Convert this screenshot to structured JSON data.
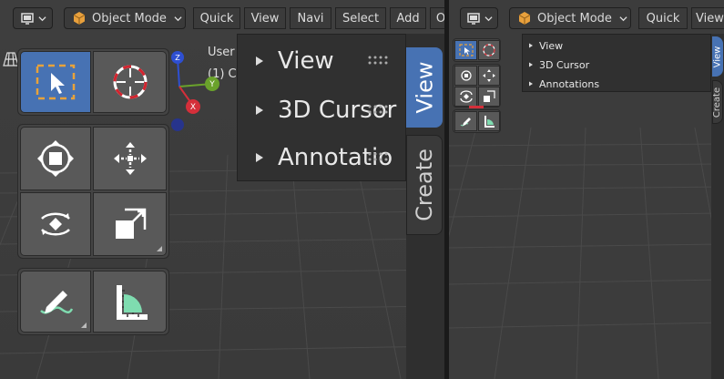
{
  "left_pane": {
    "header": {
      "editor_type_icon": "cube-display-icon",
      "mode_label": "Object Mode",
      "menus": [
        "Quick",
        "View",
        "Navi",
        "Select",
        "Add",
        "O"
      ]
    },
    "overlay": {
      "view_name": "User",
      "collection": "(1) C"
    },
    "sidebar": {
      "panels": [
        "View",
        "3D Cursor",
        "Annotatio"
      ],
      "tabs": [
        "View",
        "Create"
      ]
    }
  },
  "right_pane": {
    "header": {
      "mode_label": "Object Mode",
      "menus": [
        "Quick",
        "View"
      ]
    },
    "sidebar": {
      "panels": [
        "View",
        "3D Cursor",
        "Annotations"
      ],
      "tabs": [
        "View",
        "Create"
      ]
    }
  },
  "colors": {
    "accent": "#4772b3",
    "viewport": "#3d3d3d",
    "axis_x": "#d42f3a",
    "axis_y": "#6aa22b",
    "axis_z": "#2e4fd1"
  }
}
